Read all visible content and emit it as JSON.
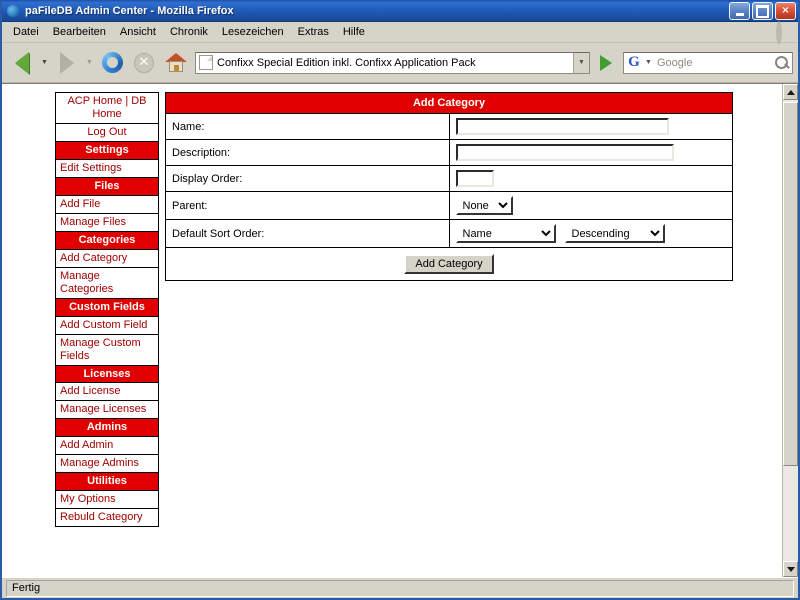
{
  "window": {
    "title": "paFileDB Admin Center - Mozilla Firefox",
    "minimize_label": "",
    "maximize_label": "",
    "close_label": "×"
  },
  "menubar": {
    "items": [
      {
        "label": "Datei"
      },
      {
        "label": "Bearbeiten"
      },
      {
        "label": "Ansicht"
      },
      {
        "label": "Chronik"
      },
      {
        "label": "Lesezeichen"
      },
      {
        "label": "Extras"
      },
      {
        "label": "Hilfe"
      }
    ]
  },
  "toolbar": {
    "back_title": "Zurück",
    "forward_title": "Vor",
    "reload_title": "Neu laden",
    "stop_title": "Stopp",
    "stop_glyph": "✕",
    "home_title": "Startseite",
    "url_value": "Confixx Special Edition inkl. Confixx Application Pack",
    "url_dropdown_glyph": "▼",
    "go_title": "Gehe zu",
    "search_engine": "G",
    "search_dropdown_glyph": "▼",
    "search_placeholder": "Google"
  },
  "sidebar": {
    "items": [
      {
        "label": "ACP Home | DB Home",
        "type": "link",
        "align": "center"
      },
      {
        "label": "Log Out",
        "type": "link",
        "align": "center"
      },
      {
        "label": "Settings",
        "type": "header"
      },
      {
        "label": "Edit Settings",
        "type": "link",
        "align": "left"
      },
      {
        "label": "Files",
        "type": "header"
      },
      {
        "label": "Add File",
        "type": "link",
        "align": "left"
      },
      {
        "label": "Manage Files",
        "type": "link",
        "align": "left"
      },
      {
        "label": "Categories",
        "type": "header"
      },
      {
        "label": "Add Category",
        "type": "link",
        "align": "left"
      },
      {
        "label": "Manage Categories",
        "type": "link",
        "align": "left"
      },
      {
        "label": "Custom Fields",
        "type": "header"
      },
      {
        "label": "Add Custom Field",
        "type": "link",
        "align": "left"
      },
      {
        "label": "Manage Custom Fields",
        "type": "link",
        "align": "left"
      },
      {
        "label": "Licenses",
        "type": "header"
      },
      {
        "label": "Add License",
        "type": "link",
        "align": "left"
      },
      {
        "label": "Manage Licenses",
        "type": "link",
        "align": "left"
      },
      {
        "label": "Admins",
        "type": "header"
      },
      {
        "label": "Add Admin",
        "type": "link",
        "align": "left"
      },
      {
        "label": "Manage Admins",
        "type": "link",
        "align": "left"
      },
      {
        "label": "Utilities",
        "type": "header"
      },
      {
        "label": "My Options",
        "type": "link",
        "align": "left"
      },
      {
        "label": "Rebuld Category",
        "type": "link",
        "align": "left"
      }
    ]
  },
  "form": {
    "heading": "Add Category",
    "rows": {
      "name_label": "Name:",
      "name_value": "",
      "description_label": "Description:",
      "description_value": "",
      "display_order_label": "Display Order:",
      "display_order_value": "",
      "parent_label": "Parent:",
      "parent_value": "None",
      "sort_label": "Default Sort Order:",
      "sort_field_value": "Name",
      "sort_dir_value": "Descending"
    },
    "submit_label": "Add Category"
  },
  "scrollbar": {
    "up_glyph": "",
    "down_glyph": ""
  },
  "statusbar": {
    "text": "Fertig"
  },
  "colors": {
    "accent_red": "#e00000",
    "link_red": "#a00000",
    "chrome_grey": "#d6d3c8",
    "title_blue": "#1c50a8"
  }
}
